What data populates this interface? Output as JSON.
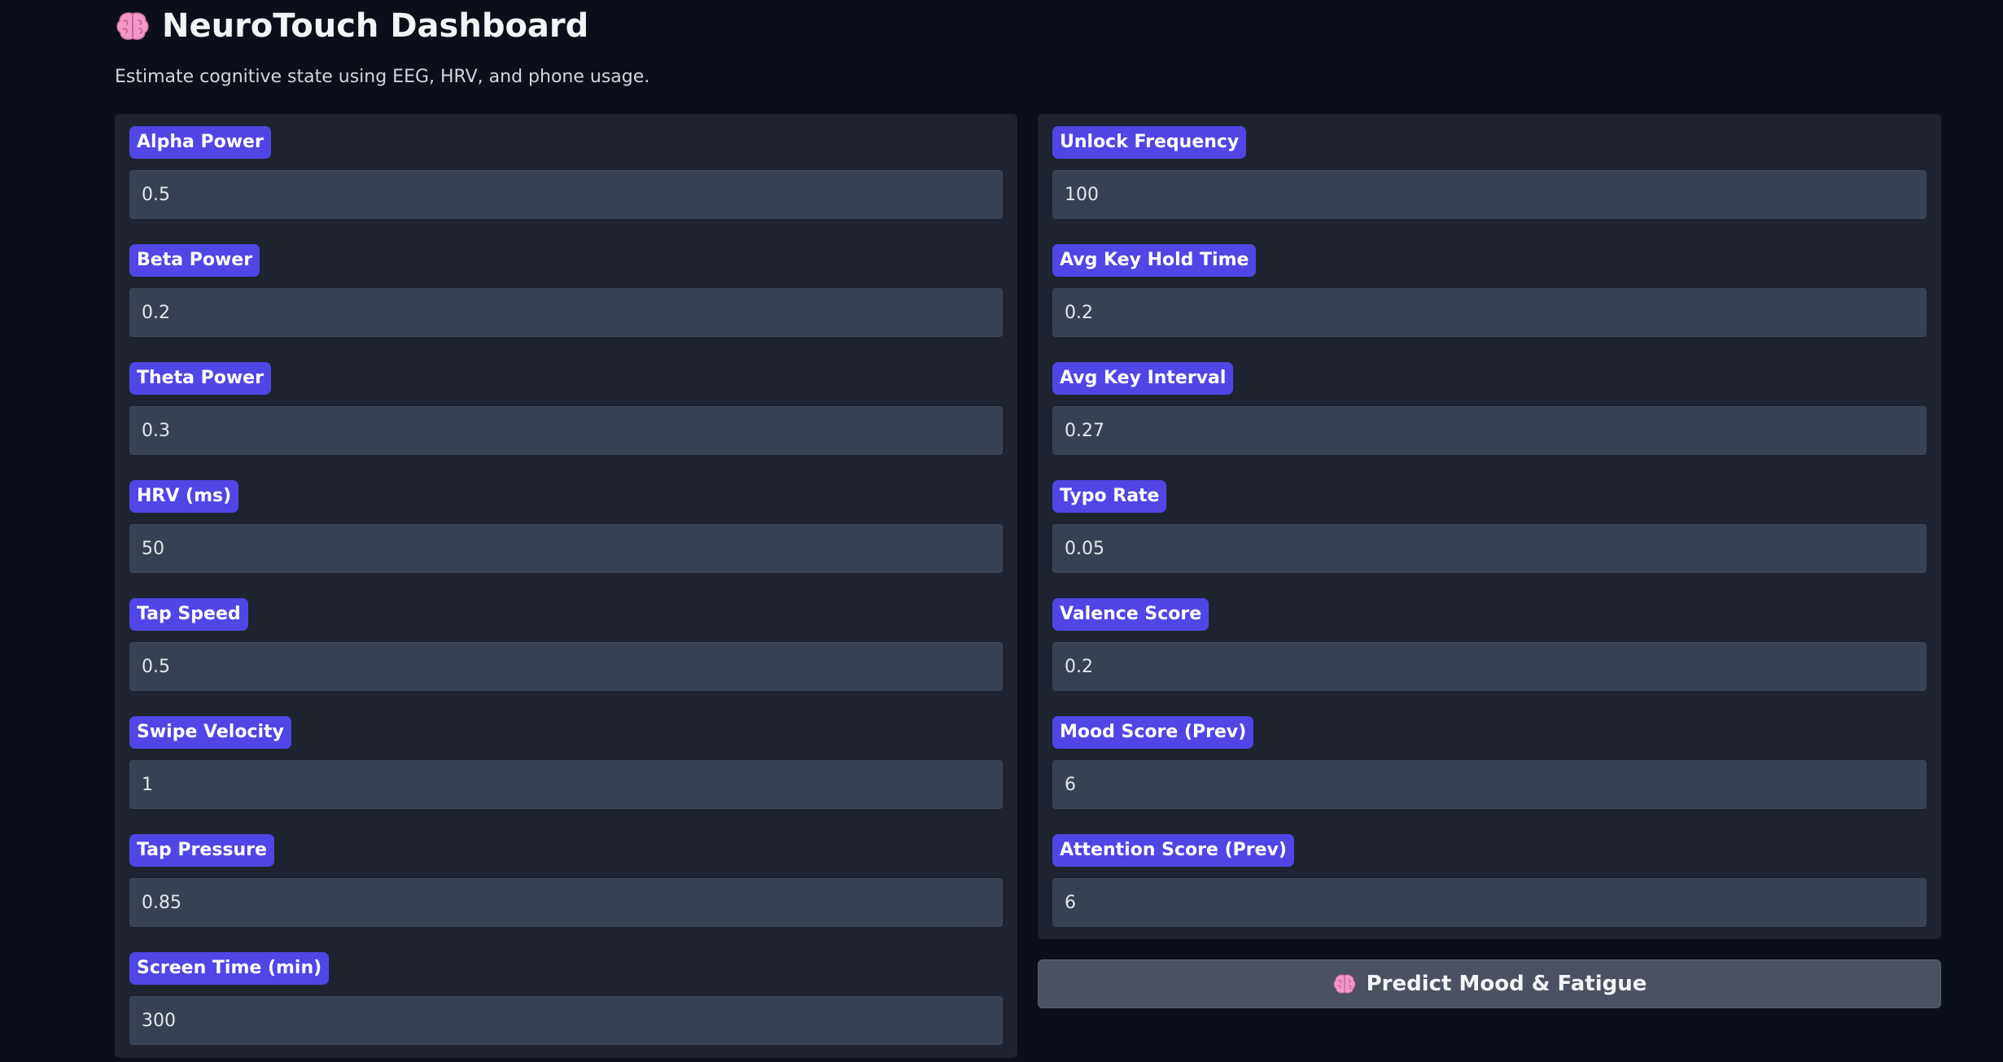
{
  "header": {
    "title": "NeuroTouch Dashboard",
    "icon": "brain-icon",
    "subtitle": "Estimate cognitive state using EEG, HRV, and phone usage."
  },
  "left_fields": [
    {
      "label": "Alpha Power",
      "value": "0.5"
    },
    {
      "label": "Beta Power",
      "value": "0.2"
    },
    {
      "label": "Theta Power",
      "value": "0.3"
    },
    {
      "label": "HRV (ms)",
      "value": "50"
    },
    {
      "label": "Tap Speed",
      "value": "0.5"
    },
    {
      "label": "Swipe Velocity",
      "value": "1"
    },
    {
      "label": "Tap Pressure",
      "value": "0.85"
    },
    {
      "label": "Screen Time (min)",
      "value": "300"
    }
  ],
  "right_fields": [
    {
      "label": "Unlock Frequency",
      "value": "100"
    },
    {
      "label": "Avg Key Hold Time",
      "value": "0.2"
    },
    {
      "label": "Avg Key Interval",
      "value": "0.27"
    },
    {
      "label": "Typo Rate",
      "value": "0.05"
    },
    {
      "label": "Valence Score",
      "value": "0.2"
    },
    {
      "label": "Mood Score (Prev)",
      "value": "6"
    },
    {
      "label": "Attention Score (Prev)",
      "value": "6"
    }
  ],
  "predict_button": {
    "label": "Predict Mood & Fatigue",
    "icon": "brain-icon"
  },
  "colors": {
    "background": "#0b0f19",
    "panel": "#1f2330",
    "label_badge": "#4f46e5",
    "input": "#374151",
    "button": "#4b5160",
    "brain": "#f29ac6"
  }
}
